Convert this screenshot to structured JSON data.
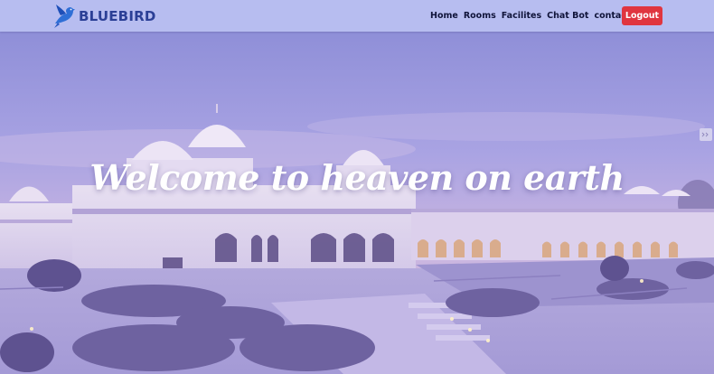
{
  "brand": {
    "name": "BLUEBIRD",
    "logo_icon": "bluebird-logo-icon"
  },
  "nav": {
    "links": [
      {
        "label": "Home"
      },
      {
        "label": "Rooms"
      },
      {
        "label": "Facilites"
      },
      {
        "label": "Chat Bot"
      },
      {
        "label": "contact us"
      }
    ],
    "logout_label": "Logout"
  },
  "hero": {
    "title": "Welcome to heaven on earth",
    "background_icon": "palace-hotel-image"
  },
  "colors": {
    "navbar_bg": "#b7bdf0",
    "brand_text": "#2b3f96",
    "logout_bg": "#e0353f",
    "hero_overlay": "#a59cf0"
  }
}
